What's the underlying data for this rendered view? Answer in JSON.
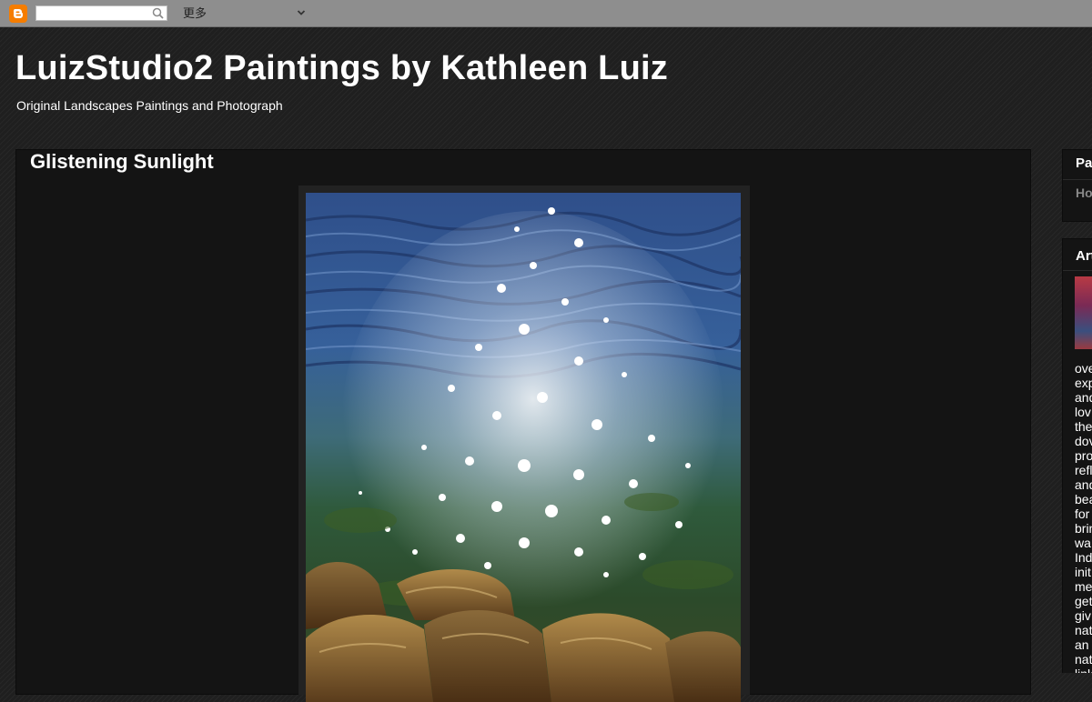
{
  "navbar": {
    "search_placeholder": "",
    "more_label": "更多"
  },
  "header": {
    "title": "LuizStudio2 Paintings by Kathleen Luiz",
    "description": "Original Landscapes Paintings and Photograph"
  },
  "post": {
    "title": "Glistening Sunlight"
  },
  "sidebar": {
    "pages_title": "Pa",
    "pages_item": "Ho",
    "artist_title": "Art",
    "about_lines": [
      "ove",
      "exp",
      "and",
      "lov",
      "the",
      "dov",
      "pro",
      "refl",
      "and",
      "bea",
      "for",
      "brin",
      "wa",
      "Ind",
      "init",
      "me",
      "get",
      "giv",
      "nat",
      "an",
      "nat",
      "link"
    ]
  },
  "colors": {
    "page_background": "#1f1f1f",
    "panel_background": "#141414",
    "navbar_background": "#8e8e8e",
    "blogger_orange": "#f57d00",
    "link_gray": "#888888"
  }
}
